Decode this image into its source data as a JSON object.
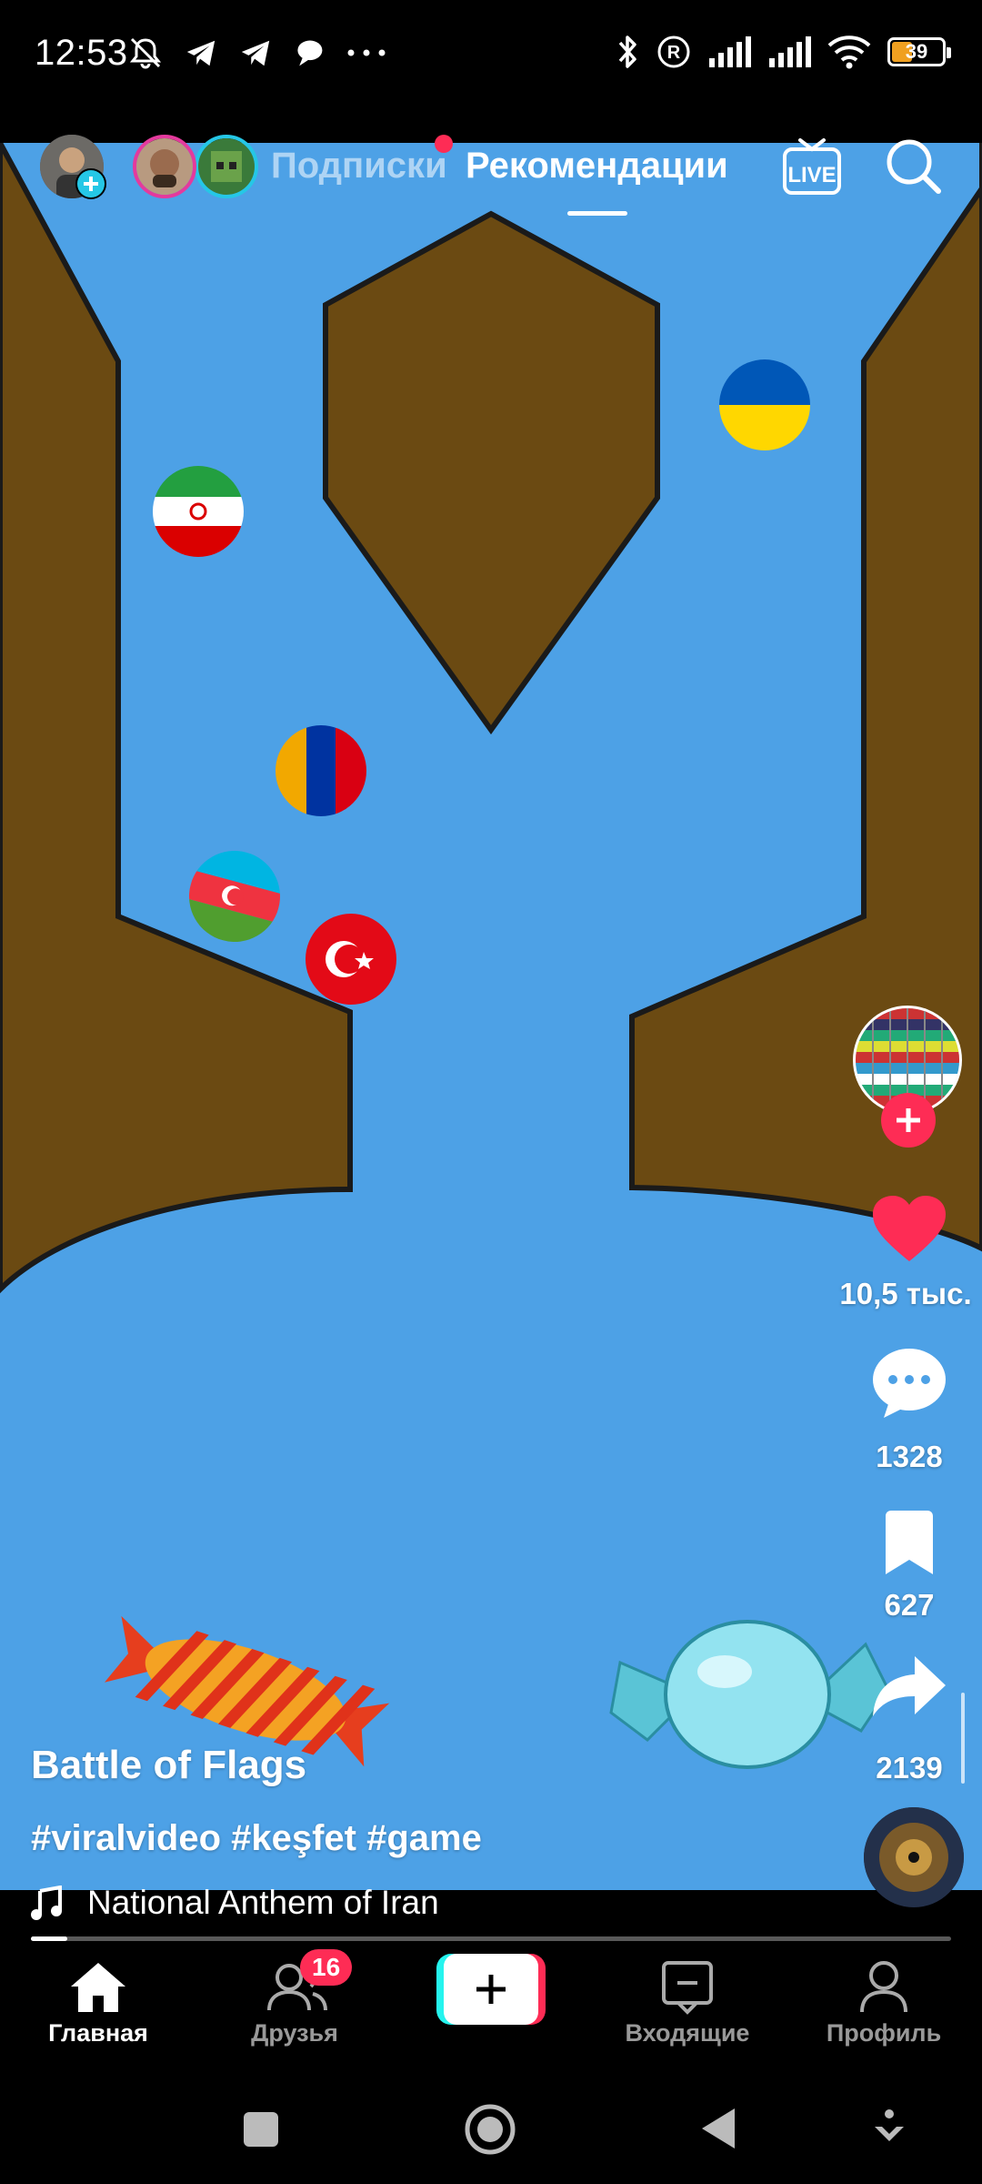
{
  "status_bar": {
    "time": "12:53",
    "battery": "39",
    "battery_level": 0.39,
    "icons": [
      "bell-off-icon",
      "telegram-icon",
      "telegram-icon",
      "chat-bubble-icon",
      "more-dots-icon",
      "bluetooth-icon",
      "roaming-r-icon",
      "signal-icon",
      "signal-icon",
      "wifi-icon",
      "battery-icon"
    ]
  },
  "top_nav": {
    "tabs": [
      {
        "label": "Подписки",
        "active": false,
        "has_dot": true
      },
      {
        "label": "Рекомендации",
        "active": true
      }
    ],
    "live_label": "LIVE",
    "live_icon": "live-tv-icon",
    "search_icon": "search-icon"
  },
  "video": {
    "background_color": "#4da1e6",
    "wall_color": "#6b4a12",
    "flags": [
      "iran-flag",
      "ukraine-flag",
      "armenia-flag",
      "azerbaijan-flag",
      "turkey-flag"
    ]
  },
  "rail": {
    "author_avatar": "world-flags-globe",
    "likes": "10,5 тыс.",
    "comments": "1328",
    "saves": "627",
    "shares": "2139"
  },
  "caption": {
    "title": "Battle of Flags",
    "hashtags": "#viralvideo #keşfet #game",
    "music": "National Anthem of Iran"
  },
  "progress": {
    "fraction": 0.04
  },
  "bottom_nav": {
    "items": [
      {
        "label": "Главная",
        "icon": "home-icon",
        "active": true
      },
      {
        "label": "Друзья",
        "icon": "friends-icon",
        "active": false,
        "badge": "16"
      },
      {
        "label": "",
        "icon": "create-plus-icon"
      },
      {
        "label": "Входящие",
        "icon": "inbox-icon",
        "active": false
      },
      {
        "label": "Профиль",
        "icon": "profile-icon",
        "active": false
      }
    ]
  },
  "system_nav": [
    "recents-square-icon",
    "home-circle-icon",
    "back-triangle-icon",
    "down-arrow-icon"
  ],
  "colors": {
    "accent": "#fe2c55",
    "like": "#fe2c55",
    "cyan": "#25f4ee",
    "battery": "#f0a020"
  }
}
